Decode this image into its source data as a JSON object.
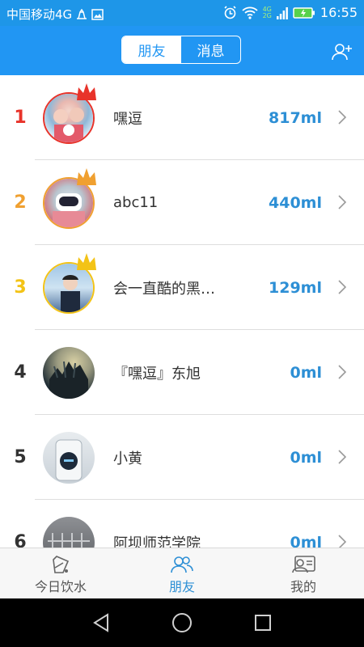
{
  "status_bar": {
    "carrier": "中国移动4G",
    "net_top": "4G",
    "net_bottom": "2G",
    "time": "16:55"
  },
  "header": {
    "tabs": [
      {
        "label": "朋友",
        "active": true
      },
      {
        "label": "消息",
        "active": false
      }
    ],
    "add_friend_icon": "add-user-icon"
  },
  "rank_colors": {
    "first": "#e8332a",
    "second": "#f0a030",
    "third": "#f3c316",
    "default": "#333333"
  },
  "accent_color": "#2d8fd5",
  "ranking": [
    {
      "rank": "1",
      "name": "嘿逗",
      "value": "817ml"
    },
    {
      "rank": "2",
      "name": "abc11",
      "value": "440ml"
    },
    {
      "rank": "3",
      "name": "会一直酷的黑…",
      "value": "129ml"
    },
    {
      "rank": "4",
      "name": "『嘿逗』东旭",
      "value": "0ml"
    },
    {
      "rank": "5",
      "name": "小黄",
      "value": "0ml"
    },
    {
      "rank": "6",
      "name": "阿坝师范学院",
      "value": "0ml"
    }
  ],
  "tab_bar": {
    "items": [
      {
        "label": "今日饮水",
        "icon": "water-cup-icon",
        "active": false
      },
      {
        "label": "朋友",
        "icon": "friends-icon",
        "active": true
      },
      {
        "label": "我的",
        "icon": "profile-card-icon",
        "active": false
      }
    ]
  },
  "nav_bar": {
    "back_icon": "back-triangle-icon",
    "home_icon": "home-circle-icon",
    "recents_icon": "recents-square-icon"
  }
}
